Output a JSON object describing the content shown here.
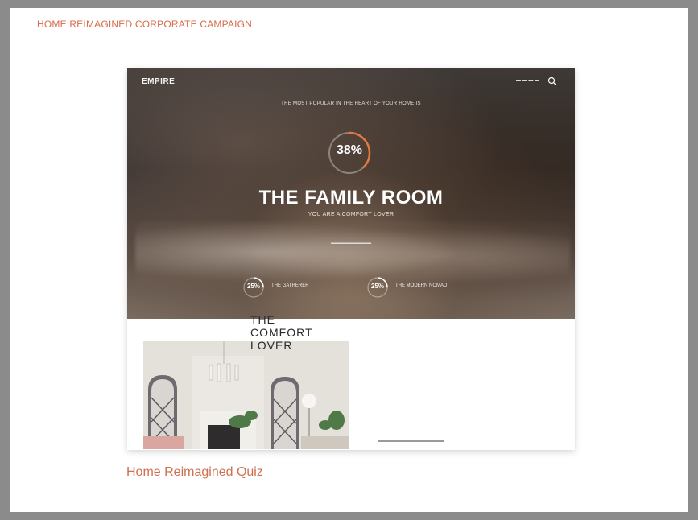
{
  "page": {
    "title": "HOME REIMAGINED CORPORATE CAMPAIGN",
    "link_label": "Home Reimagined Quiz"
  },
  "hero": {
    "logo": "EMPIRE",
    "kicker": "THE MOST POPULAR IN THE HEART OF YOUR HOME IS",
    "main_percent": "38%",
    "title": "THE FAMILY ROOM",
    "subtitle": "YOU ARE A COMFORT LOVER",
    "stats": [
      {
        "percent": "25%",
        "label": "THE GATHERER"
      },
      {
        "percent": "25%",
        "label": "THE MODERN NOMAD"
      }
    ]
  },
  "result": {
    "heading_line1": "THE",
    "heading_line2": "COMFORT",
    "heading_line3": "LOVER"
  },
  "colors": {
    "accent": "#d96a4a",
    "frame": "#8b8b8b",
    "ring": "#e07a42"
  }
}
